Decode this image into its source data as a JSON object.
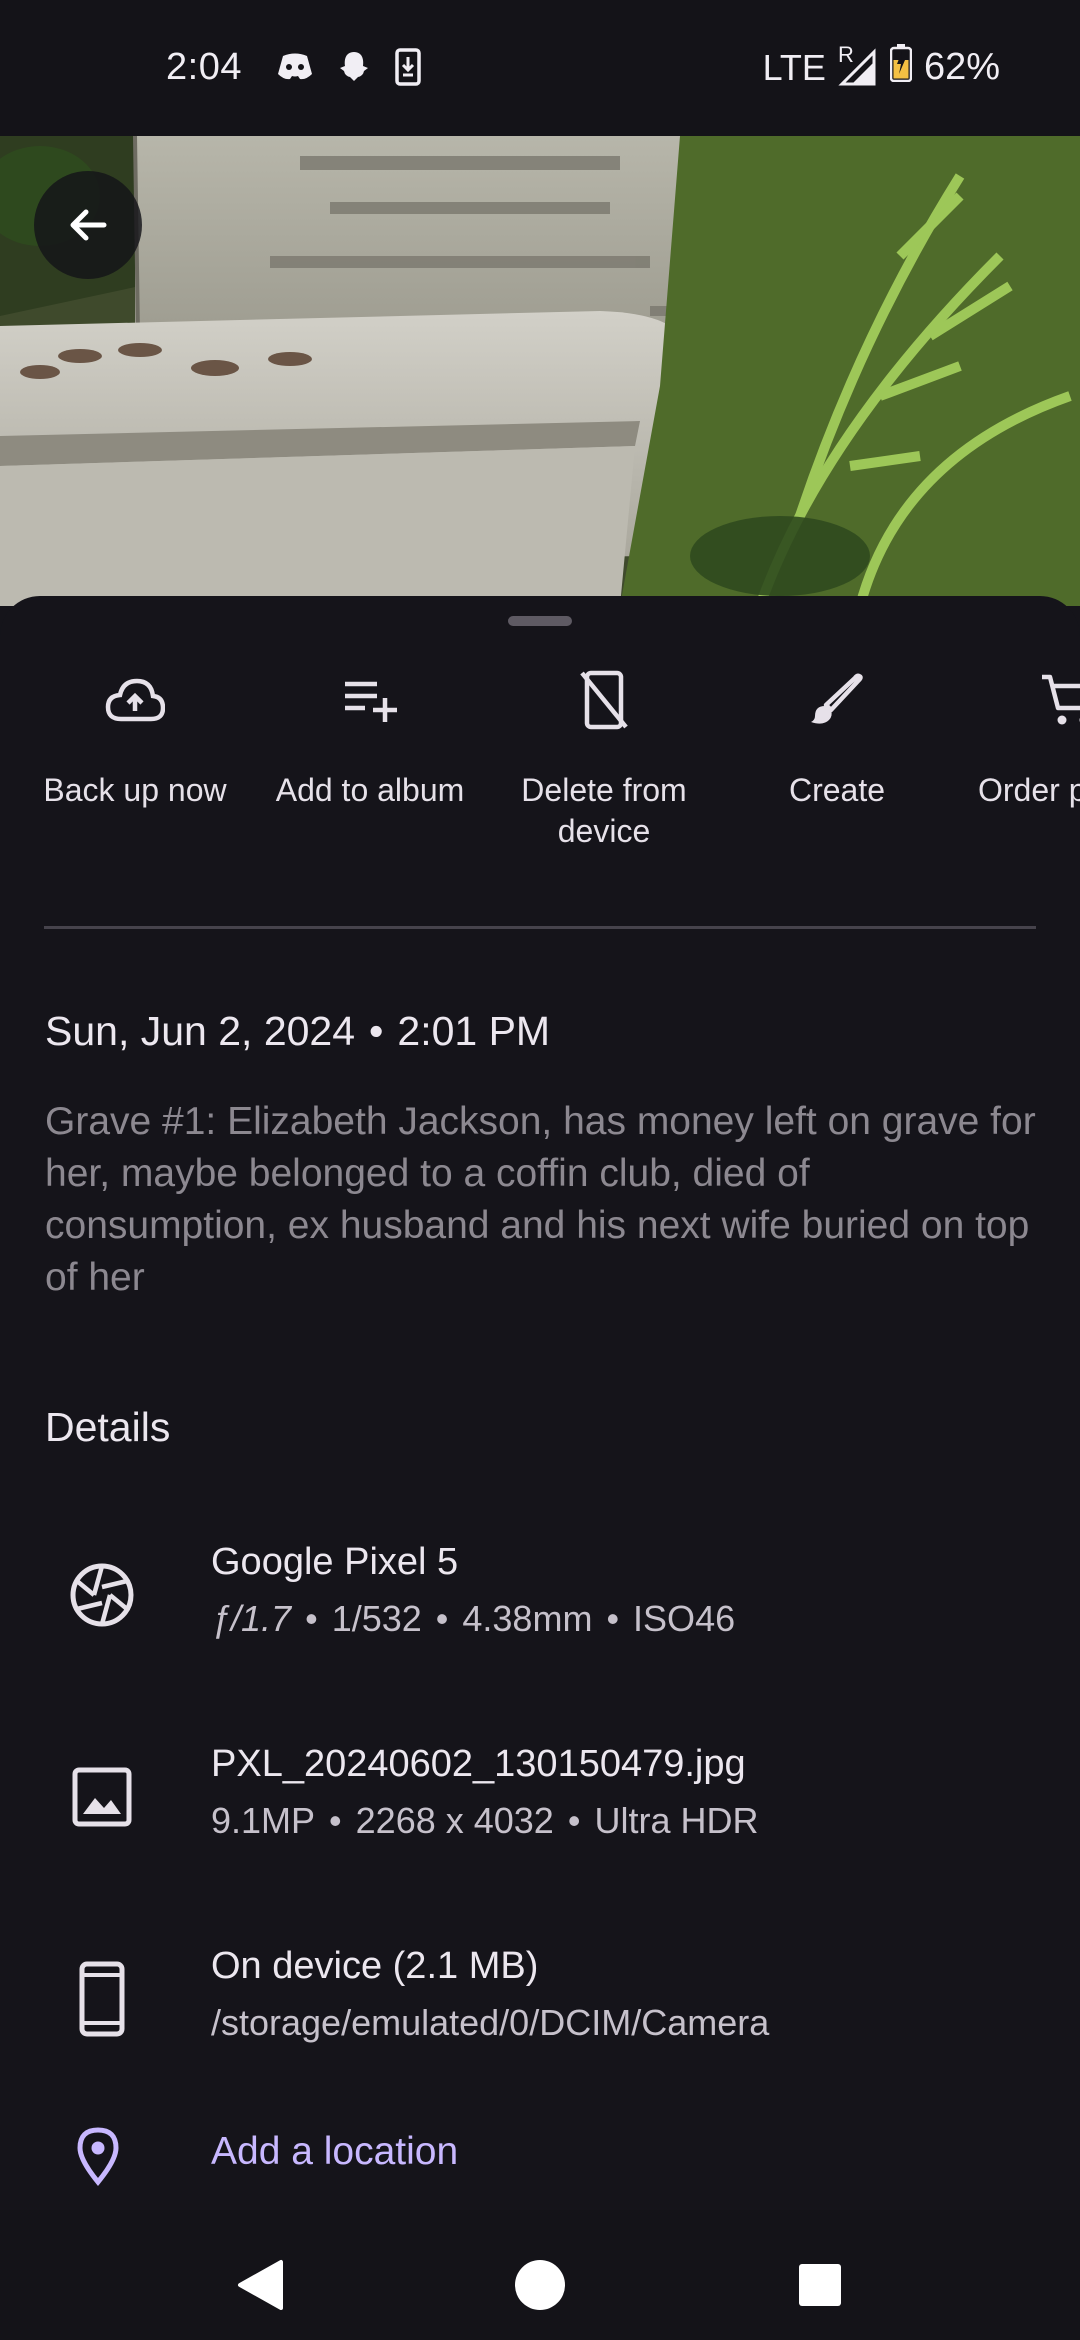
{
  "status_bar": {
    "time": "2:04",
    "network": "LTE",
    "roaming": "R",
    "battery": "62%"
  },
  "actions": [
    {
      "label": "Back up now",
      "icon": "cloud-upload-icon"
    },
    {
      "label": "Add to album",
      "icon": "playlist-add-icon"
    },
    {
      "label": "Delete from device",
      "icon": "phone-delete-icon"
    },
    {
      "label": "Create",
      "icon": "brush-icon"
    },
    {
      "label": "Order p",
      "icon": "cart-icon"
    }
  ],
  "photo_info": {
    "date": "Sun, Jun 2, 2024",
    "time": "2:01 PM",
    "caption": "Grave #1: Elizabeth Jackson, has money left on grave for her, maybe belonged to a coffin club, died of consumption, ex husband and his next wife buried on top of her"
  },
  "details": {
    "heading": "Details",
    "camera": {
      "title": "Google Pixel 5",
      "aperture": "ƒ/1.7",
      "shutter": "1/532",
      "focal": "4.38mm",
      "iso": "ISO46"
    },
    "file": {
      "title": "PXL_20240602_130150479.jpg",
      "megapixels": "9.1MP",
      "resolution": "2268 x 4032",
      "format": "Ultra HDR"
    },
    "storage": {
      "title": "On device (2.1 MB)",
      "path": "/storage/emulated/0/DCIM/Camera"
    },
    "location": {
      "label": "Add a location"
    }
  },
  "colors": {
    "background": "#15141a",
    "accent_link": "#c8b8ff",
    "caption_text": "#8c8890"
  }
}
